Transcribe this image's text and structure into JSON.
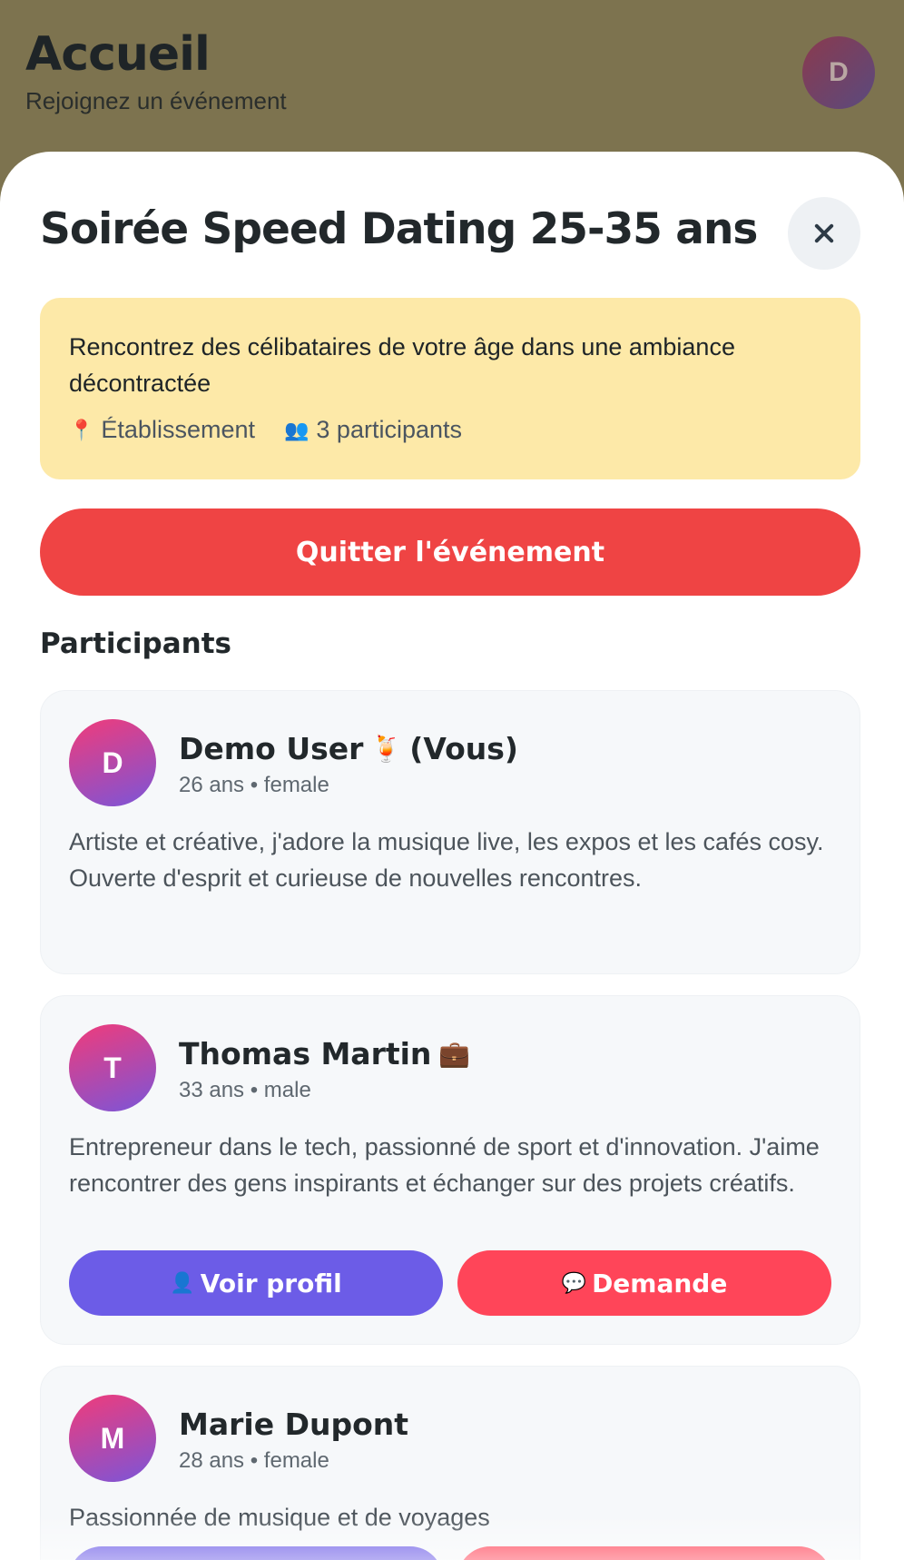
{
  "header": {
    "title": "Accueil",
    "subtitle": "Rejoignez un événement",
    "avatar_initial": "D"
  },
  "event": {
    "title": "Soirée Speed Dating 25-35 ans",
    "description": "Rencontrez des célibataires de votre âge dans une ambiance décontractée",
    "location_icon": "📍",
    "location": "Établissement",
    "participants_icon": "👥",
    "participants_count": "3 participants",
    "quit_label": "Quitter l'événement"
  },
  "participants_section": {
    "title": "Participants",
    "items": [
      {
        "initial": "D",
        "name": "Demo User",
        "emoji": "🍹",
        "suffix": "(Vous)",
        "details": "26 ans • female",
        "bio": "Artiste et créative, j'adore la musique live, les expos et les cafés cosy. Ouverte d'esprit et curieuse de nouvelles rencontres."
      },
      {
        "initial": "T",
        "name": "Thomas Martin",
        "emoji": "💼",
        "details": "33 ans • male",
        "bio": "Entrepreneur dans le tech, passionné de sport et d'innovation. J'aime rencontrer des gens inspirants et échanger sur des projets créatifs.",
        "profile_icon": "👤",
        "profile_label": "Voir profil",
        "request_icon": "💬",
        "request_label": "Demande"
      },
      {
        "initial": "M",
        "name": "Marie Dupont",
        "details": "28 ans • female",
        "bio": "Passionnée de musique et de voyages"
      }
    ]
  },
  "colors": {
    "overlay_bg": "#7d734f",
    "info_bg": "#fde9a8",
    "quit": "#ef4444",
    "profile_btn": "#6c5ce7",
    "request_btn": "#ff4559"
  }
}
